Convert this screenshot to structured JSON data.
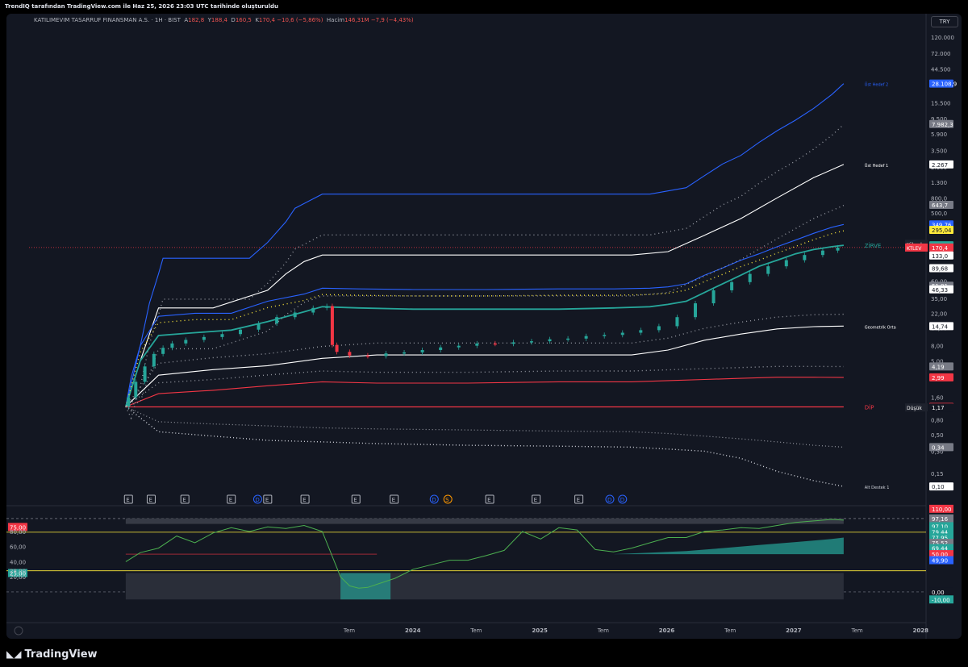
{
  "header": {
    "caption": "TrendIQ tarafından TradingView.com ile Haz 25, 2026 23:03 UTC tarihinde oluşturuldu"
  },
  "footer": {
    "logo_text": "TradingView"
  },
  "colors": {
    "bg": "#131722",
    "blue": "#2962ff",
    "green": "#26a69a",
    "red": "#f23645",
    "yellow": "#ffeb3b",
    "white": "#ffffff",
    "grey": "#787b86"
  },
  "chart_data": {
    "type": "line",
    "symbol": "KATILIMEVIM TASARRUF FINANSMAN A.S. · 1H · BIST",
    "currency": "TRY",
    "scale": "log",
    "ohlc": {
      "o_label": "A",
      "o": "182,8",
      "h_label": "Y",
      "h": "188,4",
      "l_label": "D",
      "l": "160,5",
      "c_label": "K",
      "c": "170,4",
      "change": "−10,6 (−5,86%)",
      "vol_label": "Hacim",
      "vol": "146,31M −7,9 (−4,43%)"
    },
    "x_ticks": [
      "Tem",
      "2024",
      "Tem",
      "2025",
      "Tem",
      "2026",
      "Tem",
      "2027",
      "Tem",
      "2028"
    ],
    "y_ticks": [
      "120.000",
      "72.000",
      "44.500",
      "27.500",
      "15.500",
      "9.500",
      "5.900",
      "3.500",
      "2.100",
      "1.300",
      "800,0",
      "500,0",
      "300,0",
      "150,0",
      "60,00",
      "35,00",
      "22,00",
      "14,00",
      "8,00",
      "5,00",
      "3,00",
      "1,60",
      "0,80",
      "0,50",
      "0,30",
      "0,15"
    ],
    "x_domain": [
      0,
      100
    ],
    "time_index": "months since 2023-01",
    "level_names": {
      "ust2": "Üst Hedef 2",
      "ust1": "Üst Hedef 1",
      "zirve": "ZİRVE",
      "geo": "Geometrik Orta",
      "dip": "DİP",
      "alt1": "Alt Destek 1"
    },
    "price_labels": [
      {
        "text": "28.108,9",
        "value": 28108.9,
        "color": "#2962ff"
      },
      {
        "text": "7.982,3",
        "value": 7982.3,
        "color": "#787b86"
      },
      {
        "text": "2.267",
        "value": 2267,
        "color": "#ffffff"
      },
      {
        "text": "643,7",
        "value": 643.7,
        "color": "#787b86"
      },
      {
        "text": "349,76",
        "value": 349.76,
        "color": "#2962ff"
      },
      {
        "text": "295,04",
        "value": 295.04,
        "color": "#ffeb3b"
      },
      {
        "text": "191,2",
        "value": 191.2,
        "color": "#131722",
        "tag": "Yüksek"
      },
      {
        "text": "182,8",
        "value": 182.8,
        "color": "#26a69a"
      },
      {
        "text": "176,4",
        "value": 176.4,
        "color": "#26a69a"
      },
      {
        "text": "170,4",
        "value": 170.4,
        "color": "#f23645",
        "tag": "KTLEV",
        "sub": "16:06:31"
      },
      {
        "text": "133,0",
        "value": 133.0,
        "color": "#ffffff"
      },
      {
        "text": "89,68",
        "value": 89.68,
        "color": "#ffffff"
      },
      {
        "text": "51,91",
        "value": 51.91,
        "color": "#787b86"
      },
      {
        "text": "46,33",
        "value": 46.33,
        "color": "#ffffff"
      },
      {
        "text": "14,74",
        "value": 14.74,
        "color": "#ffffff"
      },
      {
        "text": "4,19",
        "value": 4.19,
        "color": "#787b86"
      },
      {
        "text": "2,99",
        "value": 2.99,
        "color": "#f23645"
      },
      {
        "text": "1,19",
        "value": 1.19,
        "color": "#f23645"
      },
      {
        "text": "1,17",
        "value": 1.17,
        "color": "#131722",
        "tag": "Düşük"
      },
      {
        "text": "0,34",
        "value": 0.34,
        "color": "#787b86"
      },
      {
        "text": "0,10",
        "value": 0.1,
        "color": "#ffffff"
      }
    ],
    "price": {
      "x": [
        12.4,
        13,
        14,
        15,
        16,
        17,
        18,
        20,
        22,
        24,
        26,
        28,
        30,
        32,
        34,
        35,
        35.2,
        36,
        38,
        40,
        42,
        44,
        46,
        48,
        50,
        52,
        54,
        56,
        58,
        60,
        62,
        64,
        66,
        68,
        70,
        72,
        74,
        76,
        78,
        80,
        82,
        84,
        86,
        88,
        90,
        91.3
      ],
      "y": [
        1.2,
        1.6,
        2.6,
        4.2,
        6.2,
        7.5,
        8.6,
        9.6,
        10.5,
        11.5,
        13.2,
        16,
        19.5,
        22.5,
        26,
        27.5,
        8.2,
        6.6,
        5.9,
        5.8,
        6.3,
        6.5,
        7.0,
        7.6,
        8.0,
        8.6,
        8.5,
        8.9,
        9.2,
        9.8,
        10.0,
        10.8,
        11.2,
        12.0,
        13.0,
        14.7,
        19.5,
        30,
        45,
        58,
        75,
        95,
        115,
        135,
        155,
        170.4
      ]
    },
    "bands": [
      {
        "name": "ust2",
        "color": "#2962ff",
        "x": [
          12.4,
          13,
          14,
          15,
          16,
          16.5,
          22,
          26,
          28,
          30,
          31,
          34,
          40,
          48,
          54,
          62,
          68,
          70,
          74,
          76,
          78,
          80,
          82,
          84,
          86,
          88,
          90,
          91.3
        ],
        "y": [
          1.2,
          3,
          8,
          30,
          75,
          122,
          122,
          122,
          200,
          380,
          580,
          900,
          900,
          900,
          900,
          900,
          900,
          900,
          1100,
          1600,
          2300,
          3000,
          4500,
          6500,
          9000,
          13000,
          20000,
          28108.9
        ]
      },
      {
        "name": "hi1",
        "color": "#ffffff",
        "x": [
          12.4,
          14,
          16,
          22,
          28,
          30,
          32,
          34,
          40,
          54,
          68,
          72,
          76,
          80,
          84,
          88,
          91.3
        ],
        "y": [
          1.2,
          5,
          26,
          26,
          45,
          75,
          110,
          135,
          135,
          135,
          135,
          150,
          250,
          420,
          800,
          1500,
          2267
        ]
      },
      {
        "name": "blueband",
        "color": "#2962ff",
        "x": [
          12.4,
          14,
          16,
          20,
          24,
          28,
          32,
          34,
          38,
          44,
          52,
          60,
          66,
          70,
          72,
          74,
          76,
          78,
          80,
          82,
          84,
          86,
          88,
          90,
          91.3
        ],
        "y": [
          1.2,
          8,
          20,
          22,
          22,
          32,
          40,
          48,
          47,
          46,
          46,
          47,
          47,
          48,
          50,
          55,
          72,
          90,
          115,
          140,
          175,
          215,
          265,
          320,
          349.76
        ]
      },
      {
        "name": "green",
        "color": "#26a69a",
        "x": [
          12.4,
          14,
          16,
          20,
          24,
          28,
          32,
          34,
          38,
          44,
          52,
          60,
          66,
          70,
          72,
          74,
          76,
          78,
          80,
          82,
          84,
          86,
          88,
          90,
          91.3
        ],
        "y": [
          1.2,
          5,
          11,
          12,
          13,
          17,
          23,
          27,
          26,
          25,
          25,
          25,
          26,
          27,
          29,
          32,
          42,
          55,
          72,
          95,
          115,
          140,
          160,
          175,
          182.8
        ]
      },
      {
        "name": "geo",
        "color": "#ffffff",
        "x": [
          12.4,
          16,
          22,
          28,
          34,
          40,
          50,
          60,
          68,
          72,
          76,
          80,
          84,
          88,
          91.3
        ],
        "y": [
          1.2,
          3.2,
          3.8,
          4.3,
          5.4,
          6.0,
          6.0,
          6.0,
          6.0,
          7.0,
          9.5,
          11.5,
          13.5,
          14.5,
          14.74
        ]
      },
      {
        "name": "red",
        "color": "#f23645",
        "x": [
          12.4,
          16,
          22,
          28,
          34,
          40,
          50,
          60,
          68,
          72,
          76,
          80,
          84,
          88,
          91.3
        ],
        "y": [
          1.2,
          1.8,
          2.0,
          2.3,
          2.6,
          2.5,
          2.5,
          2.6,
          2.6,
          2.7,
          2.8,
          2.9,
          3.0,
          3.0,
          2.99
        ]
      },
      {
        "name": "dip",
        "color": "#f23645",
        "x": [
          12.4,
          91.3
        ],
        "y": [
          1.19,
          1.19
        ]
      }
    ],
    "oscillator": {
      "y_ticks": [
        "110,00",
        "97,30",
        "97,16",
        "80,00",
        "60,00",
        "40,00",
        "28,00",
        "25,00",
        "20,00",
        "0,00",
        "-10,00"
      ],
      "right_labels": [
        {
          "text": "110,00",
          "value": 110,
          "color": "#f23645"
        },
        {
          "text": "97,30",
          "value": 97.3,
          "color": "#787b86"
        },
        {
          "text": "97,16",
          "value": 97.16,
          "color": "#787b86"
        },
        {
          "text": "97,10",
          "value": 87,
          "color": "#26a69a"
        },
        {
          "text": "79,44",
          "value": 79.44,
          "color": "#26a69a"
        },
        {
          "text": "77,95",
          "value": 72,
          "color": "#26a69a"
        },
        {
          "text": "75,52",
          "value": 65,
          "color": "#787b86"
        },
        {
          "text": "69,44",
          "value": 58,
          "color": "#26a69a"
        },
        {
          "text": "50,00",
          "value": 50,
          "color": "#f23645"
        },
        {
          "text": "49,90",
          "value": 42,
          "color": "#2962ff"
        },
        {
          "text": "0,00",
          "value": 0,
          "color": "#131722"
        },
        {
          "text": "-10,00",
          "value": -10,
          "color": "#26a69a"
        }
      ],
      "left_labels": [
        {
          "text": "75,00",
          "value": 86,
          "color": "#f23645"
        },
        {
          "text": "25,00",
          "value": 25,
          "color": "#26a69a"
        }
      ],
      "line": {
        "x": [
          12.4,
          14,
          16,
          18,
          20,
          22,
          24,
          26,
          28,
          30,
          32,
          34,
          35,
          36,
          37,
          38,
          39,
          40,
          42,
          44,
          46,
          48,
          50,
          52,
          54,
          56,
          58,
          60,
          62,
          64,
          66,
          68,
          70,
          72,
          74,
          76,
          78,
          80,
          82,
          84,
          86,
          88,
          90,
          91.3
        ],
        "y": [
          40,
          52,
          58,
          74,
          65,
          78,
          85,
          80,
          86,
          84,
          88,
          80,
          50,
          20,
          8,
          5,
          6,
          10,
          18,
          30,
          36,
          42,
          42,
          48,
          55,
          80,
          70,
          85,
          82,
          56,
          53,
          58,
          65,
          72,
          72,
          80,
          82,
          85,
          84,
          88,
          92,
          94,
          96,
          95
        ]
      },
      "events": [
        "E",
        "E",
        "E",
        "E",
        "D",
        "E",
        "E",
        "E",
        "E",
        "D",
        "S",
        "E",
        "E",
        "E",
        "D",
        "D"
      ]
    }
  }
}
